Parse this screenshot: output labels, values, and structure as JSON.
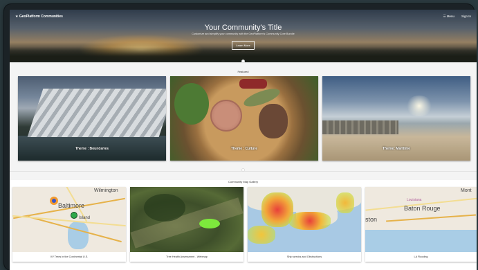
{
  "nav": {
    "brand": "GeoPlatform Communities",
    "menu_label": "☰ Menu",
    "signin_label": "Sign In"
  },
  "hero": {
    "title": "Your Community's Title",
    "subtitle": "Customize and simplify your community with the GeoPlatform's Community Core Bundle",
    "button_label": "Learn More"
  },
  "featured": {
    "label": "Featured",
    "items": [
      {
        "caption": "Theme : Boundaries"
      },
      {
        "caption": "Theme : Culture"
      },
      {
        "caption": "Theme: Maritime"
      }
    ]
  },
  "gallery": {
    "label": "Community Map Gallery",
    "items": [
      {
        "caption": "VV Trees in the Continental U.S.",
        "labels": [
          "Wilmington",
          "Baltimore",
          "Island"
        ]
      },
      {
        "caption": "Tree Health Assessment - Webmap",
        "labels": []
      },
      {
        "caption": "Ship wrecks and Obstructions",
        "labels": []
      },
      {
        "caption": "LA Flooding",
        "labels": [
          "Mont",
          "Louisiana",
          "Baton Rouge",
          "ston"
        ]
      }
    ]
  },
  "colors": {
    "accent_orange": "#f39a2e",
    "marker_green": "#2fa84a",
    "marker_blue": "#3a56c8"
  }
}
